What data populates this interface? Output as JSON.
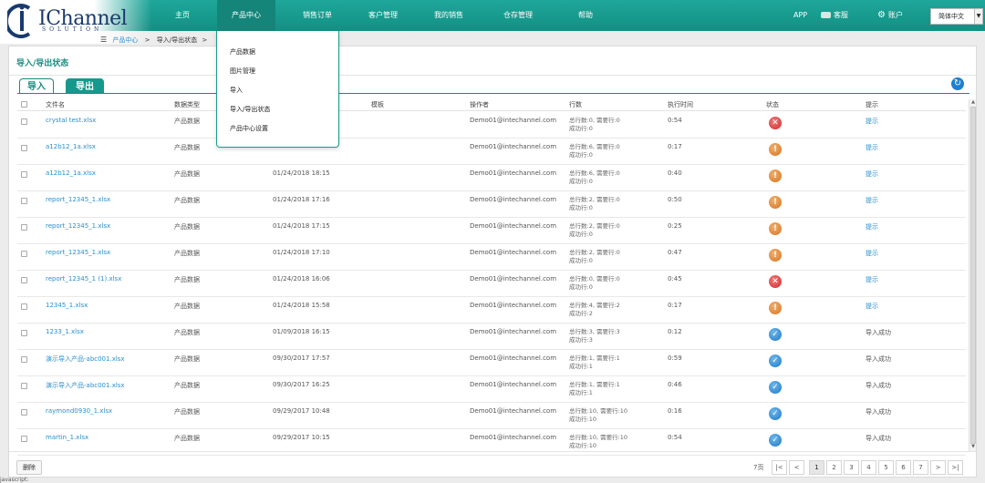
{
  "brand": {
    "logo_text": "IChannel",
    "logo_sub": "SOLUTION"
  },
  "nav": [
    {
      "label": "主页"
    },
    {
      "label": "产品中心"
    },
    {
      "label": "销售订单"
    },
    {
      "label": "客户管理"
    },
    {
      "label": "我的销售"
    },
    {
      "label": "仓存管理"
    },
    {
      "label": "帮助"
    }
  ],
  "nav_right": {
    "app": "APP",
    "service": "客服",
    "account": "账户",
    "lang": "简体中文"
  },
  "breadcrumb": {
    "home_icon": "menu-icon",
    "product_center": "产品中心",
    "separator": ">",
    "current": "导入/导出状态"
  },
  "dropdown": {
    "items": [
      {
        "label": "产品数据"
      },
      {
        "label": "图片管理"
      },
      {
        "label": "导入"
      },
      {
        "label": "导入/导出状态"
      },
      {
        "label": "产品中心设置"
      }
    ]
  },
  "panel": {
    "title": "导入/导出状态"
  },
  "tabs": {
    "import": "导入",
    "export": "导出"
  },
  "columns": [
    "文件名",
    "数据类型",
    "",
    "模板",
    "操作者",
    "行数",
    "执行时间",
    "状态",
    "提示"
  ],
  "rows": [
    {
      "file": "crystal test.xlsx",
      "type": "产品数据",
      "time": "",
      "operator": "Demo01@intechannel.com",
      "rows_total": "总行数:0, 需要行:0",
      "rows_ok": "成功行:0",
      "exec": "0:54",
      "status": "error",
      "hint": "提示"
    },
    {
      "file": "a12b12_1a.xlsx",
      "type": "产品数据",
      "time": "",
      "operator": "Demo01@intechannel.com",
      "rows_total": "总行数:6, 需要行:0",
      "rows_ok": "成功行:0",
      "exec": "0:17",
      "status": "warn",
      "hint": "提示"
    },
    {
      "file": "a12b12_1a.xlsx",
      "type": "产品数据",
      "time": "01/24/2018 18:15",
      "operator": "Demo01@intechannel.com",
      "rows_total": "总行数:6, 需要行:0",
      "rows_ok": "成功行:0",
      "exec": "0:40",
      "status": "warn",
      "hint": "提示"
    },
    {
      "file": "report_12345_1.xlsx",
      "type": "产品数据",
      "time": "01/24/2018 17:16",
      "operator": "Demo01@intechannel.com",
      "rows_total": "总行数:2, 需要行:0",
      "rows_ok": "成功行:0",
      "exec": "0:50",
      "status": "warn",
      "hint": "提示"
    },
    {
      "file": "report_12345_1.xlsx",
      "type": "产品数据",
      "time": "01/24/2018 17:15",
      "operator": "Demo01@intechannel.com",
      "rows_total": "总行数:2, 需要行:0",
      "rows_ok": "成功行:0",
      "exec": "0:25",
      "status": "warn",
      "hint": "提示"
    },
    {
      "file": "report_12345_1.xlsx",
      "type": "产品数据",
      "time": "01/24/2018 17:10",
      "operator": "Demo01@intechannel.com",
      "rows_total": "总行数:2, 需要行:0",
      "rows_ok": "成功行:0",
      "exec": "0:47",
      "status": "warn",
      "hint": "提示"
    },
    {
      "file": "report_12345_1 (1).xlsx",
      "type": "产品数据",
      "time": "01/24/2018 16:06",
      "operator": "Demo01@intechannel.com",
      "rows_total": "总行数:0, 需要行:0",
      "rows_ok": "成功行:0",
      "exec": "0:45",
      "status": "error",
      "hint": "提示"
    },
    {
      "file": "12345_1.xlsx",
      "type": "产品数据",
      "time": "01/24/2018 15:58",
      "operator": "Demo01@intechannel.com",
      "rows_total": "总行数:4, 需要行:2",
      "rows_ok": "成功行:2",
      "exec": "0:17",
      "status": "warn",
      "hint": "提示"
    },
    {
      "file": "1233_1.xlsx",
      "type": "产品数据",
      "time": "01/09/2018 16:15",
      "operator": "Demo01@intechannel.com",
      "rows_total": "总行数:3, 需要行:3",
      "rows_ok": "成功行:3",
      "exec": "0:12",
      "status": "ok",
      "hint": "导入成功"
    },
    {
      "file": "演示导入产品-abc001.xlsx",
      "type": "产品数据",
      "time": "09/30/2017 17:57",
      "operator": "Demo01@intechannel.com",
      "rows_total": "总行数:1, 需要行:1",
      "rows_ok": "成功行:1",
      "exec": "0:59",
      "status": "ok",
      "hint": "导入成功"
    },
    {
      "file": "演示导入产品-abc001.xlsx",
      "type": "产品数据",
      "time": "09/30/2017 16:25",
      "operator": "Demo01@intechannel.com",
      "rows_total": "总行数:1, 需要行:1",
      "rows_ok": "成功行:1",
      "exec": "0:46",
      "status": "ok",
      "hint": "导入成功"
    },
    {
      "file": "raymond0930_1.xlsx",
      "type": "产品数据",
      "time": "09/29/2017 10:48",
      "operator": "Demo01@intechannel.com",
      "rows_total": "总行数:10, 需要行:10",
      "rows_ok": "成功行:10",
      "exec": "0:16",
      "status": "ok",
      "hint": "导入成功"
    },
    {
      "file": "martin_1.xlsx",
      "type": "产品数据",
      "time": "09/29/2017 10:15",
      "operator": "Demo01@intechannel.com",
      "rows_total": "总行数:10, 需要行:10",
      "rows_ok": "成功行:10",
      "exec": "0:54",
      "status": "ok",
      "hint": "导入成功"
    }
  ],
  "footer": {
    "delete": "删除",
    "total_pages": "7页",
    "pager": [
      "|<",
      "<",
      "1",
      "2",
      "3",
      "4",
      "5",
      "6",
      "7",
      ">",
      ">|"
    ],
    "current_page": "1"
  },
  "status_bar": "javascript:",
  "colors": {
    "brand": "#16998d",
    "link": "#2a8fd0",
    "error": "#d12b2b",
    "warn": "#d6731f",
    "ok": "#1f78c6"
  }
}
